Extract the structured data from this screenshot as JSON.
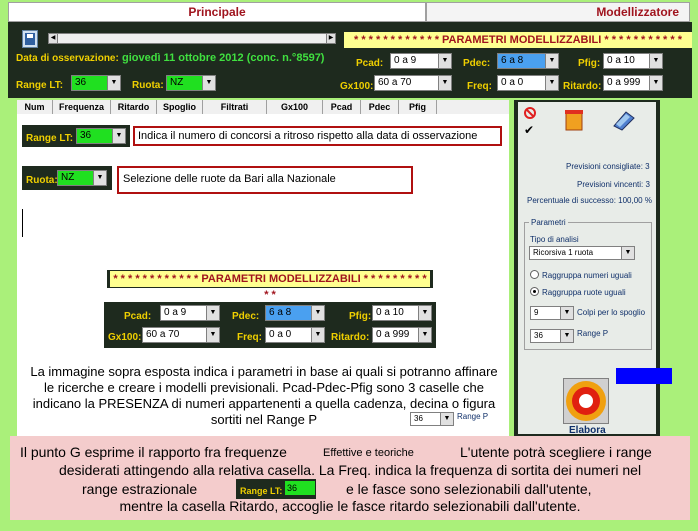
{
  "tabs": {
    "main": "Principale",
    "model": "Modellizzatore"
  },
  "observation": {
    "label": "Data di osservazione:",
    "value": "giovedì 11 ottobre 2012 (conc. n.°8597)"
  },
  "params_banner": "* * * * * * * * * * * * PARAMETRI MODELLIZZABILI * * * * * * * * * * *",
  "controls": {
    "range_lt": {
      "label": "Range LT:",
      "value": "36"
    },
    "ruota": {
      "label": "Ruota:",
      "value": "NZ"
    },
    "pcad": {
      "label": "Pcad:",
      "value": "0 a 9"
    },
    "pdec": {
      "label": "Pdec:",
      "value": "6 a 8"
    },
    "pfig": {
      "label": "Pfig:",
      "value": "0 a 10"
    },
    "gx100": {
      "label": "Gx100:",
      "value": "60 a 70"
    },
    "freq": {
      "label": "Freq:",
      "value": "0 a 0"
    },
    "ritardo": {
      "label": "Ritardo:",
      "value": "0 a 999"
    }
  },
  "table_headers": [
    "Num",
    "Frequenza",
    "Ritardo",
    "Spoglio",
    "Filtrati",
    "Gx100",
    "Pcad",
    "Pdec",
    "Pfig"
  ],
  "callouts": {
    "range_lt": "Indica il numero di concorsi a ritroso rispetto alla data di osservazione",
    "ruota": "Selezione delle ruote da Bari alla Nazionale"
  },
  "description": "La immagine sopra esposta indica i parametri in base ai quali si potranno affinare le ricerche e creare i modelli previsionali. Pcad-Pdec-Pfig sono 3 caselle che indicano la PRESENZA di numeri appartenenti a quella cadenza, decina o figura sortiti nel Range P",
  "range_p_inline": {
    "value": "36",
    "label": "Range P"
  },
  "right_panel": {
    "previsioni_consigliate": "Previsioni consigliate: 3",
    "previsioni_vincenti": "Previsioni vincenti: 3",
    "percentuale": "Percentuale di successo: 100,00 %",
    "group_title": "Parametri",
    "tipo_label": "Tipo di analisi",
    "tipo_value": "Ricorsiva 1 ruota",
    "radio1": "Raggruppa numeri uguali",
    "radio2": "Raggruppa ruote uguali",
    "colpi_value": "9",
    "colpi_label": "Colpi per lo spoglio",
    "rangep_value": "36",
    "rangep_label": "Range P",
    "elabora": "Elabora"
  },
  "footer": {
    "line1a": "Il punto G esprime il rapporto fra frequenze",
    "line1b": "Effettive e teoriche",
    "line1c": "L'utente potrà scegliere i range",
    "line2": "desiderati attingendo alla relativa casella. La Freq. indica la frequenza di sortita dei numeri nel",
    "line3a": "range estrazionale",
    "line3b": "e le fasce sono selezionabili dall'utente,",
    "line4": "mentre la casella Ritardo, accoglie le fasce ritardo selezionabili dall'utente.",
    "range_lt_label": "Range LT:",
    "range_lt_value": "36"
  },
  "colors": {
    "frame": "#aaf07a",
    "dark": "#1e2a1e",
    "accent": "#f0d000",
    "pink": "#f4cccc",
    "callout_border": "#b01010"
  }
}
